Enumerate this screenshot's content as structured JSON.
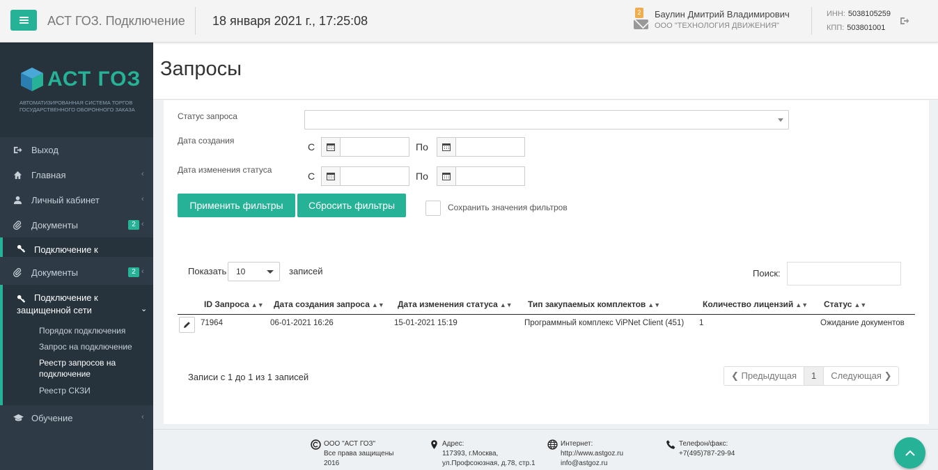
{
  "header": {
    "app_title": "АСТ ГОЗ. Подключение",
    "datetime": "18 января 2021 г., 17:25:08",
    "notification_count": "2",
    "user_name": "Баулин Дмитрий Владимирович",
    "user_org": "ООО \"ТЕХНОЛОГИЯ ДВИЖЕНИЯ\"",
    "inn_label": "ИНН:",
    "inn_value": "5038105259",
    "kpp_label": "КПП:",
    "kpp_value": "503801001"
  },
  "logo": {
    "text": "АСТ ГОЗ",
    "subtitle": "Автоматизированная система торгов государственного оборонного заказа"
  },
  "sidebar": {
    "items": [
      {
        "label": "Выход"
      },
      {
        "label": "Главная"
      },
      {
        "label": "Личный кабинет"
      },
      {
        "label": "Документы",
        "count": "2"
      },
      {
        "label": "Подключение к"
      },
      {
        "label": "Документы",
        "count": "2"
      }
    ],
    "active_section": {
      "label_line1": "Подключение к",
      "label_line2": "защищенной сети",
      "links": [
        {
          "label": "Порядок подключения"
        },
        {
          "label": "Запрос на подключение"
        },
        {
          "label_line1": "Реестр запросов на",
          "label_line2": "подключение"
        },
        {
          "label": "Реестр СКЗИ"
        }
      ]
    },
    "last_item": {
      "label": "Обучение"
    }
  },
  "page": {
    "title": "Запросы"
  },
  "filters": {
    "status_label": "Статус запроса",
    "status_value": "",
    "created_label": "Дата создания",
    "changed_label": "Дата изменения статуса",
    "from_label": "С",
    "to_label": "По",
    "apply_button": "Применить фильтры",
    "reset_button": "Сбросить фильтры",
    "save_label": "Сохранить значения фильтров"
  },
  "table_controls": {
    "show_label": "Показать",
    "page_size": "10",
    "records_label": "записей",
    "search_label": "Поиск:"
  },
  "table": {
    "columns": [
      "ID Запроса",
      "Дата создания запроса",
      "Дата изменения статуса",
      "Тип закупаемых комплектов",
      "Количество лицензий",
      "Статус"
    ],
    "rows": [
      [
        "71964",
        "06-01-2021 16:26",
        "15-01-2021 15:19",
        "Программный комплекс ViPNet Client (451)",
        "1",
        "Ожидание документов"
      ]
    ],
    "info": "Записи с 1 до 1 из 1 записей",
    "pager": {
      "prev": "Предыдущая",
      "page": "1",
      "next": "Следующая"
    }
  },
  "footer": {
    "company": [
      "ООО \"АСТ ГОЗ\"",
      "Все права защищены",
      "2016"
    ],
    "address": [
      "Адрес:",
      "117393, г.Москва,",
      "ул.Профсоюзная, д.78, стр.1"
    ],
    "internet": [
      "Интернет:",
      "http://www.astgoz.ru",
      "info@astgoz.ru"
    ],
    "phone": [
      "Телефон/факс:",
      "+7(495)787-29-94"
    ]
  },
  "colors": {
    "accent": "#26b297",
    "sidebar": "#2e3a46",
    "badge": "#f0ad4e"
  }
}
